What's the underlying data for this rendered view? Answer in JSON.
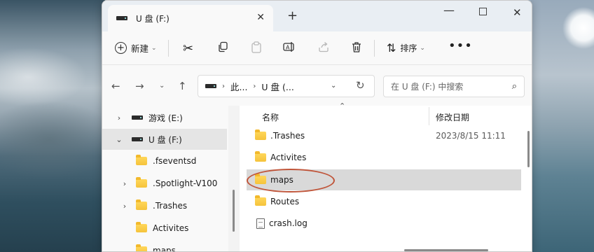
{
  "window": {
    "tab_title": "U 盘 (F:)",
    "new_tab": "+",
    "close_tab": "✕",
    "minimize": "—",
    "close": "✕"
  },
  "toolbar": {
    "new_label": "新建",
    "sort_label": "排序",
    "more": "•••"
  },
  "address": {
    "crumbs": [
      "此...",
      "U 盘 (..."
    ],
    "search_placeholder": "在 U 盘 (F:) 中搜索"
  },
  "nav": {
    "items": [
      {
        "label": "游戏 (E:)",
        "icon": "drive-icon",
        "expander": "›"
      },
      {
        "label": "U 盘 (F:)",
        "icon": "drive-icon",
        "expander": "⌄",
        "selected": true
      },
      {
        "label": ".fseventsd",
        "icon": "folder-icon",
        "expander": ""
      },
      {
        "label": ".Spotlight-V100",
        "icon": "folder-icon",
        "expander": "›"
      },
      {
        "label": ".Trashes",
        "icon": "folder-icon",
        "expander": "›"
      },
      {
        "label": "Activites",
        "icon": "folder-icon",
        "expander": ""
      },
      {
        "label": "maps",
        "icon": "folder-icon",
        "expander": ""
      }
    ]
  },
  "files": {
    "columns": {
      "name": "名称",
      "modified": "修改日期"
    },
    "rows": [
      {
        "name": ".Trashes",
        "date": "2023/8/15 11:11",
        "icon": "folder-icon"
      },
      {
        "name": "Activites",
        "date": "",
        "icon": "folder-icon"
      },
      {
        "name": "maps",
        "date": "",
        "icon": "folder-icon",
        "highlighted": true
      },
      {
        "name": "Routes",
        "date": "",
        "icon": "folder-icon"
      },
      {
        "name": "crash.log",
        "date": "",
        "icon": "file-icon"
      }
    ]
  },
  "colors": {
    "annotation_circle": "#c0553a",
    "accent": "#f5c33b"
  }
}
